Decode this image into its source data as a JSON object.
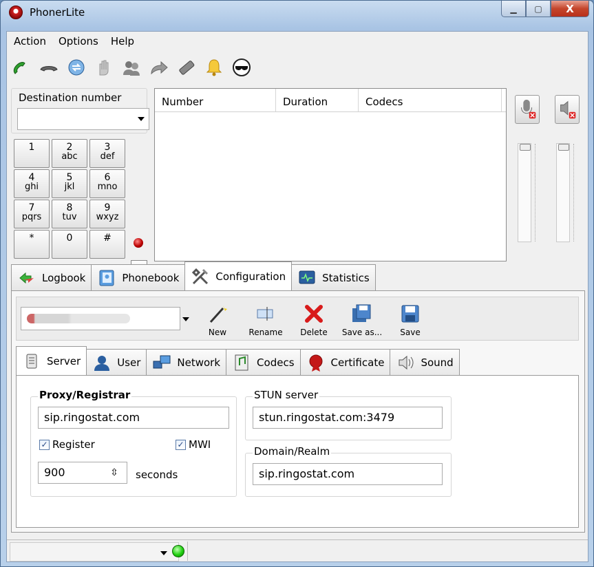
{
  "window": {
    "title": "PhonerLite",
    "min": "▁",
    "max": "▢",
    "close": "X"
  },
  "menu": [
    "Action",
    "Options",
    "Help"
  ],
  "toolbar": [
    "call-icon",
    "hangup-icon",
    "transfer-icon",
    "hold-hand-icon",
    "conference-icon",
    "forward-icon",
    "dnd-icon",
    "bell-icon",
    "sunglasses-icon"
  ],
  "dial": {
    "destination_label": "Destination number",
    "destination_value": "",
    "keys": [
      {
        "d": "1",
        "l": ""
      },
      {
        "d": "2",
        "l": "abc"
      },
      {
        "d": "3",
        "l": "def"
      },
      {
        "d": "4",
        "l": "ghi"
      },
      {
        "d": "5",
        "l": "jkl"
      },
      {
        "d": "6",
        "l": "mno"
      },
      {
        "d": "7",
        "l": "pqrs"
      },
      {
        "d": "8",
        "l": "tuv"
      },
      {
        "d": "9",
        "l": "wxyz"
      },
      {
        "d": "*",
        "l": ""
      },
      {
        "d": "0",
        "l": ""
      },
      {
        "d": "#",
        "l": ""
      }
    ],
    "next": ">"
  },
  "calllist": {
    "columns": [
      "Number",
      "Duration",
      "Codecs"
    ]
  },
  "tabs": [
    "Logbook",
    "Phonebook",
    "Configuration",
    "Statistics"
  ],
  "profile": {
    "buttons": [
      "New",
      "Rename",
      "Delete",
      "Save as...",
      "Save"
    ]
  },
  "subtabs": [
    "Server",
    "User",
    "Network",
    "Codecs",
    "Certificate",
    "Sound"
  ],
  "server": {
    "proxy_label": "Proxy/Registrar",
    "proxy_value": "sip.ringostat.com",
    "register_label": "Register",
    "mwi_label": "MWI",
    "interval": "900",
    "seconds_label": "seconds",
    "stun_label": "STUN server",
    "stun_value": "stun.ringostat.com:3479",
    "domain_label": "Domain/Realm",
    "domain_value": "sip.ringostat.com"
  },
  "colors": {
    "accent": "#2a4c88",
    "led_red": "#b00000",
    "led_green": "#20d010"
  }
}
